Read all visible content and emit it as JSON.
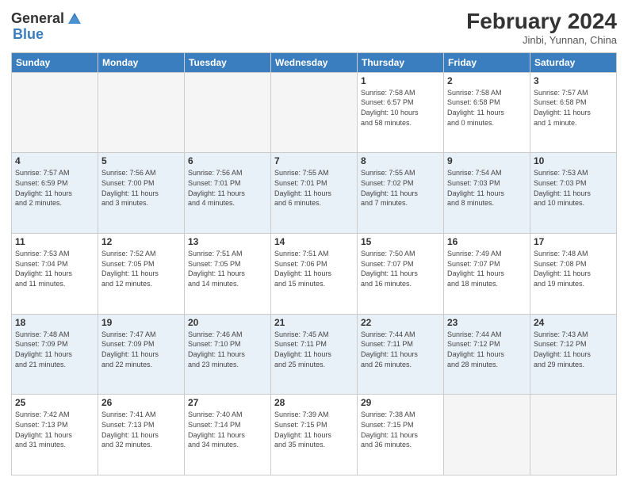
{
  "header": {
    "logo_general": "General",
    "logo_blue": "Blue",
    "month_year": "February 2024",
    "location": "Jinbi, Yunnan, China"
  },
  "days_of_week": [
    "Sunday",
    "Monday",
    "Tuesday",
    "Wednesday",
    "Thursday",
    "Friday",
    "Saturday"
  ],
  "weeks": [
    [
      {
        "date": "",
        "info": ""
      },
      {
        "date": "",
        "info": ""
      },
      {
        "date": "",
        "info": ""
      },
      {
        "date": "",
        "info": ""
      },
      {
        "date": "1",
        "info": "Sunrise: 7:58 AM\nSunset: 6:57 PM\nDaylight: 10 hours\nand 58 minutes."
      },
      {
        "date": "2",
        "info": "Sunrise: 7:58 AM\nSunset: 6:58 PM\nDaylight: 11 hours\nand 0 minutes."
      },
      {
        "date": "3",
        "info": "Sunrise: 7:57 AM\nSunset: 6:58 PM\nDaylight: 11 hours\nand 1 minute."
      }
    ],
    [
      {
        "date": "4",
        "info": "Sunrise: 7:57 AM\nSunset: 6:59 PM\nDaylight: 11 hours\nand 2 minutes."
      },
      {
        "date": "5",
        "info": "Sunrise: 7:56 AM\nSunset: 7:00 PM\nDaylight: 11 hours\nand 3 minutes."
      },
      {
        "date": "6",
        "info": "Sunrise: 7:56 AM\nSunset: 7:01 PM\nDaylight: 11 hours\nand 4 minutes."
      },
      {
        "date": "7",
        "info": "Sunrise: 7:55 AM\nSunset: 7:01 PM\nDaylight: 11 hours\nand 6 minutes."
      },
      {
        "date": "8",
        "info": "Sunrise: 7:55 AM\nSunset: 7:02 PM\nDaylight: 11 hours\nand 7 minutes."
      },
      {
        "date": "9",
        "info": "Sunrise: 7:54 AM\nSunset: 7:03 PM\nDaylight: 11 hours\nand 8 minutes."
      },
      {
        "date": "10",
        "info": "Sunrise: 7:53 AM\nSunset: 7:03 PM\nDaylight: 11 hours\nand 10 minutes."
      }
    ],
    [
      {
        "date": "11",
        "info": "Sunrise: 7:53 AM\nSunset: 7:04 PM\nDaylight: 11 hours\nand 11 minutes."
      },
      {
        "date": "12",
        "info": "Sunrise: 7:52 AM\nSunset: 7:05 PM\nDaylight: 11 hours\nand 12 minutes."
      },
      {
        "date": "13",
        "info": "Sunrise: 7:51 AM\nSunset: 7:05 PM\nDaylight: 11 hours\nand 14 minutes."
      },
      {
        "date": "14",
        "info": "Sunrise: 7:51 AM\nSunset: 7:06 PM\nDaylight: 11 hours\nand 15 minutes."
      },
      {
        "date": "15",
        "info": "Sunrise: 7:50 AM\nSunset: 7:07 PM\nDaylight: 11 hours\nand 16 minutes."
      },
      {
        "date": "16",
        "info": "Sunrise: 7:49 AM\nSunset: 7:07 PM\nDaylight: 11 hours\nand 18 minutes."
      },
      {
        "date": "17",
        "info": "Sunrise: 7:48 AM\nSunset: 7:08 PM\nDaylight: 11 hours\nand 19 minutes."
      }
    ],
    [
      {
        "date": "18",
        "info": "Sunrise: 7:48 AM\nSunset: 7:09 PM\nDaylight: 11 hours\nand 21 minutes."
      },
      {
        "date": "19",
        "info": "Sunrise: 7:47 AM\nSunset: 7:09 PM\nDaylight: 11 hours\nand 22 minutes."
      },
      {
        "date": "20",
        "info": "Sunrise: 7:46 AM\nSunset: 7:10 PM\nDaylight: 11 hours\nand 23 minutes."
      },
      {
        "date": "21",
        "info": "Sunrise: 7:45 AM\nSunset: 7:11 PM\nDaylight: 11 hours\nand 25 minutes."
      },
      {
        "date": "22",
        "info": "Sunrise: 7:44 AM\nSunset: 7:11 PM\nDaylight: 11 hours\nand 26 minutes."
      },
      {
        "date": "23",
        "info": "Sunrise: 7:44 AM\nSunset: 7:12 PM\nDaylight: 11 hours\nand 28 minutes."
      },
      {
        "date": "24",
        "info": "Sunrise: 7:43 AM\nSunset: 7:12 PM\nDaylight: 11 hours\nand 29 minutes."
      }
    ],
    [
      {
        "date": "25",
        "info": "Sunrise: 7:42 AM\nSunset: 7:13 PM\nDaylight: 11 hours\nand 31 minutes."
      },
      {
        "date": "26",
        "info": "Sunrise: 7:41 AM\nSunset: 7:13 PM\nDaylight: 11 hours\nand 32 minutes."
      },
      {
        "date": "27",
        "info": "Sunrise: 7:40 AM\nSunset: 7:14 PM\nDaylight: 11 hours\nand 34 minutes."
      },
      {
        "date": "28",
        "info": "Sunrise: 7:39 AM\nSunset: 7:15 PM\nDaylight: 11 hours\nand 35 minutes."
      },
      {
        "date": "29",
        "info": "Sunrise: 7:38 AM\nSunset: 7:15 PM\nDaylight: 11 hours\nand 36 minutes."
      },
      {
        "date": "",
        "info": ""
      },
      {
        "date": "",
        "info": ""
      }
    ]
  ]
}
